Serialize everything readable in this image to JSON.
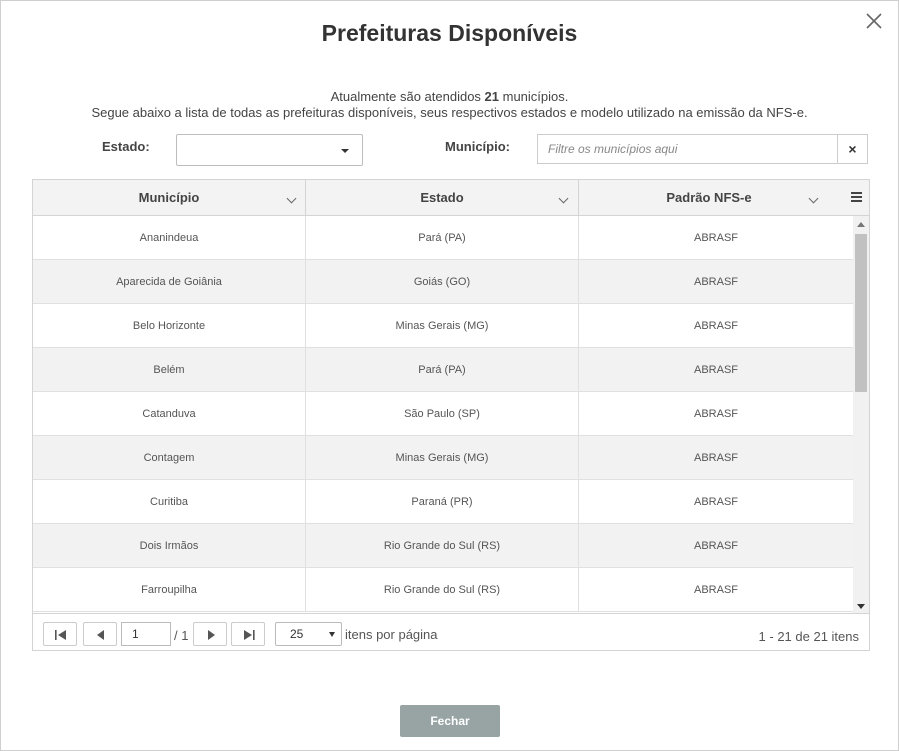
{
  "dialog": {
    "title": "Prefeituras Disponíveis",
    "intro_prefix": "Atualmente são atendidos ",
    "intro_count": "21",
    "intro_suffix": " municípios.",
    "intro_line2": "Segue abaixo a lista de todas as prefeituras disponíveis, seus respectivos estados e modelo utilizado na emissão da NFS-e.",
    "close_button": "Fechar"
  },
  "filters": {
    "estado_label": "Estado:",
    "estado_value": "",
    "municipio_label": "Município:",
    "municipio_placeholder": "Filtre os municípios aqui",
    "clear_label": "×"
  },
  "grid": {
    "columns": [
      "Município",
      "Estado",
      "Padrão NFS-e"
    ],
    "rows": [
      [
        "Ananindeua",
        "Pará (PA)",
        "ABRASF"
      ],
      [
        "Aparecida de Goiânia",
        "Goiás (GO)",
        "ABRASF"
      ],
      [
        "Belo Horizonte",
        "Minas Gerais (MG)",
        "ABRASF"
      ],
      [
        "Belém",
        "Pará (PA)",
        "ABRASF"
      ],
      [
        "Catanduva",
        "São Paulo (SP)",
        "ABRASF"
      ],
      [
        "Contagem",
        "Minas Gerais (MG)",
        "ABRASF"
      ],
      [
        "Curitiba",
        "Paraná (PR)",
        "ABRASF"
      ],
      [
        "Dois Irmãos",
        "Rio Grande do Sul (RS)",
        "ABRASF"
      ],
      [
        "Farroupilha",
        "Rio Grande do Sul (RS)",
        "ABRASF"
      ]
    ]
  },
  "pager": {
    "page_value": "1",
    "of_text": "/ 1",
    "page_size": "25",
    "page_size_label": "itens por página",
    "info": "1 - 21 de 21 itens"
  },
  "colors": {
    "header_bg": "#f3f3f3",
    "alt_row_bg": "#f2f2f2",
    "close_button_bg": "#98a3a3"
  },
  "icons": {
    "close": "close-x-icon",
    "menu": "hamburger-menu-icon",
    "sort": "chevron-down-icon",
    "first": "first-page-icon",
    "prev": "prev-page-icon",
    "next": "next-page-icon",
    "last": "last-page-icon"
  }
}
